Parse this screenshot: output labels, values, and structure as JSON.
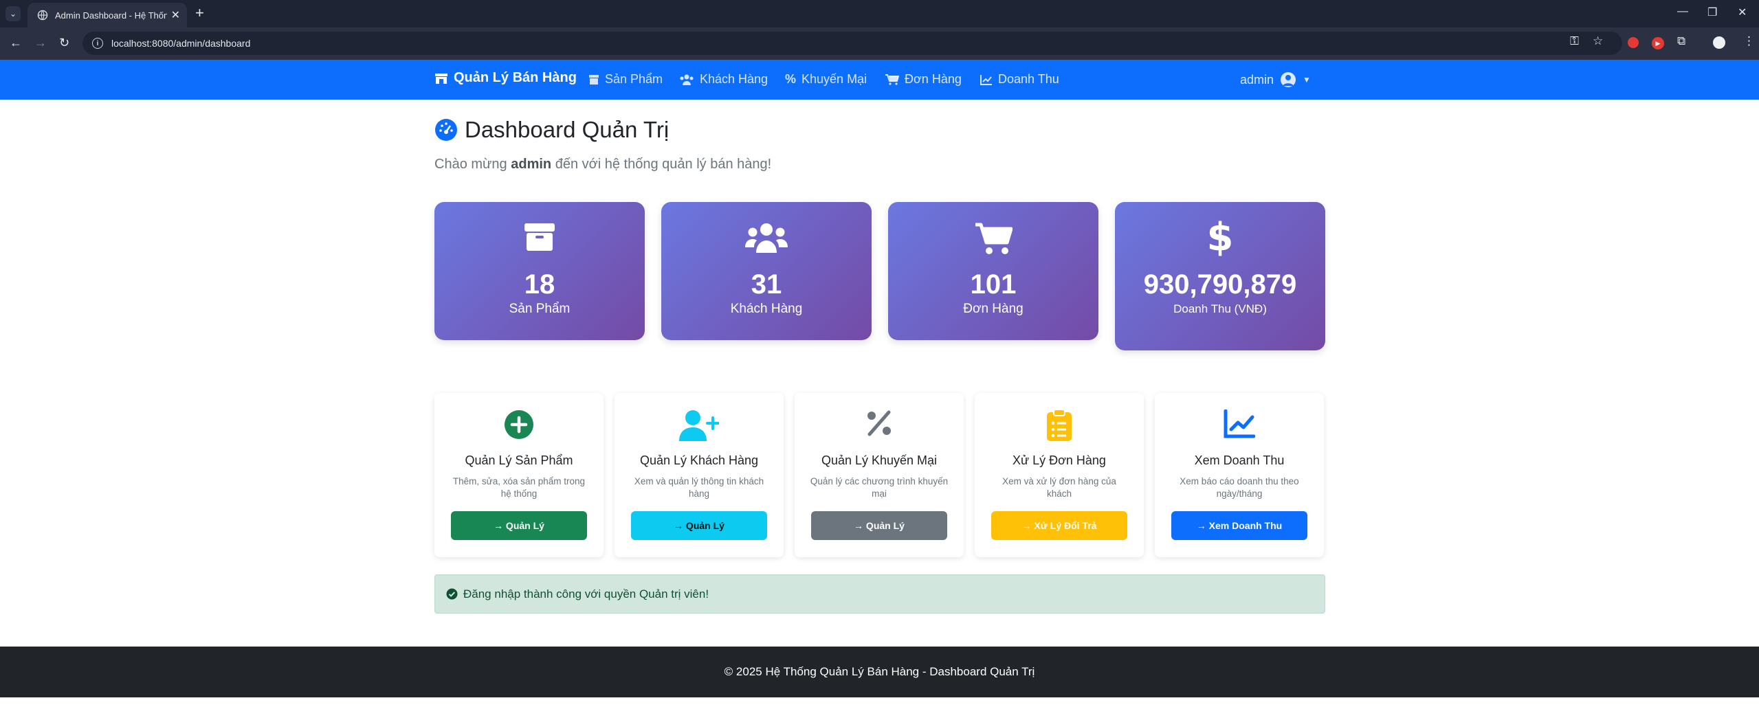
{
  "browser": {
    "tab_title": "Admin Dashboard - Hệ Thống",
    "url": "localhost:8080/admin/dashboard"
  },
  "nav": {
    "brand": "Quản Lý Bán Hàng",
    "links": [
      "Sản Phẩm",
      "Khách Hàng",
      "Khuyến Mại",
      "Đơn Hàng",
      "Doanh Thu"
    ],
    "user": "admin"
  },
  "page": {
    "title": "Dashboard Quản Trị",
    "welcome_prefix": "Chào mừng",
    "welcome_user": "admin",
    "welcome_suffix": "đến với hệ thống quản lý bán hàng!"
  },
  "stats": [
    {
      "value": "18",
      "label": "Sản Phẩm",
      "icon": "box-icon"
    },
    {
      "value": "31",
      "label": "Khách Hàng",
      "icon": "users-icon"
    },
    {
      "value": "101",
      "label": "Đơn Hàng",
      "icon": "cart-icon"
    },
    {
      "value": "930,790,879",
      "label": "Doanh Thu (VNĐ)",
      "icon": "dollar-icon"
    }
  ],
  "cards": [
    {
      "title": "Quản Lý Sản Phẩm",
      "desc": "Thêm, sửa, xóa sản phẩm trong hệ thống",
      "button": "→ Quản Lý",
      "color": "#198754",
      "icon": "plus-circle-icon"
    },
    {
      "title": "Quản Lý Khách Hàng",
      "desc": "Xem và quản lý thông tin khách hàng",
      "button": "→ Quản Lý",
      "color": "#0dcaf0",
      "icon": "user-plus-icon"
    },
    {
      "title": "Quản Lý Khuyến Mại",
      "desc": "Quản lý các chương trình khuyến mại",
      "button": "→ Quản Lý",
      "color": "#6c757d",
      "icon": "percent-icon"
    },
    {
      "title": "Xử Lý Đơn Hàng",
      "desc": "Xem và xử lý đơn hàng của khách",
      "button": "→ Xử Lý Đổi Trả",
      "color": "#ffc107",
      "icon": "clipboard-list-icon"
    },
    {
      "title": "Xem Doanh Thu",
      "desc": "Xem báo cáo doanh thu theo ngày/tháng",
      "button": "→ Xem Doanh Thu",
      "color": "#0d6efd",
      "icon": "chart-line-icon"
    }
  ],
  "alert": "Đăng nhập thành công với quyền Quản trị viên!",
  "footer": "© 2025 Hệ Thống Quản Lý Bán Hàng - Dashboard Quản Trị"
}
